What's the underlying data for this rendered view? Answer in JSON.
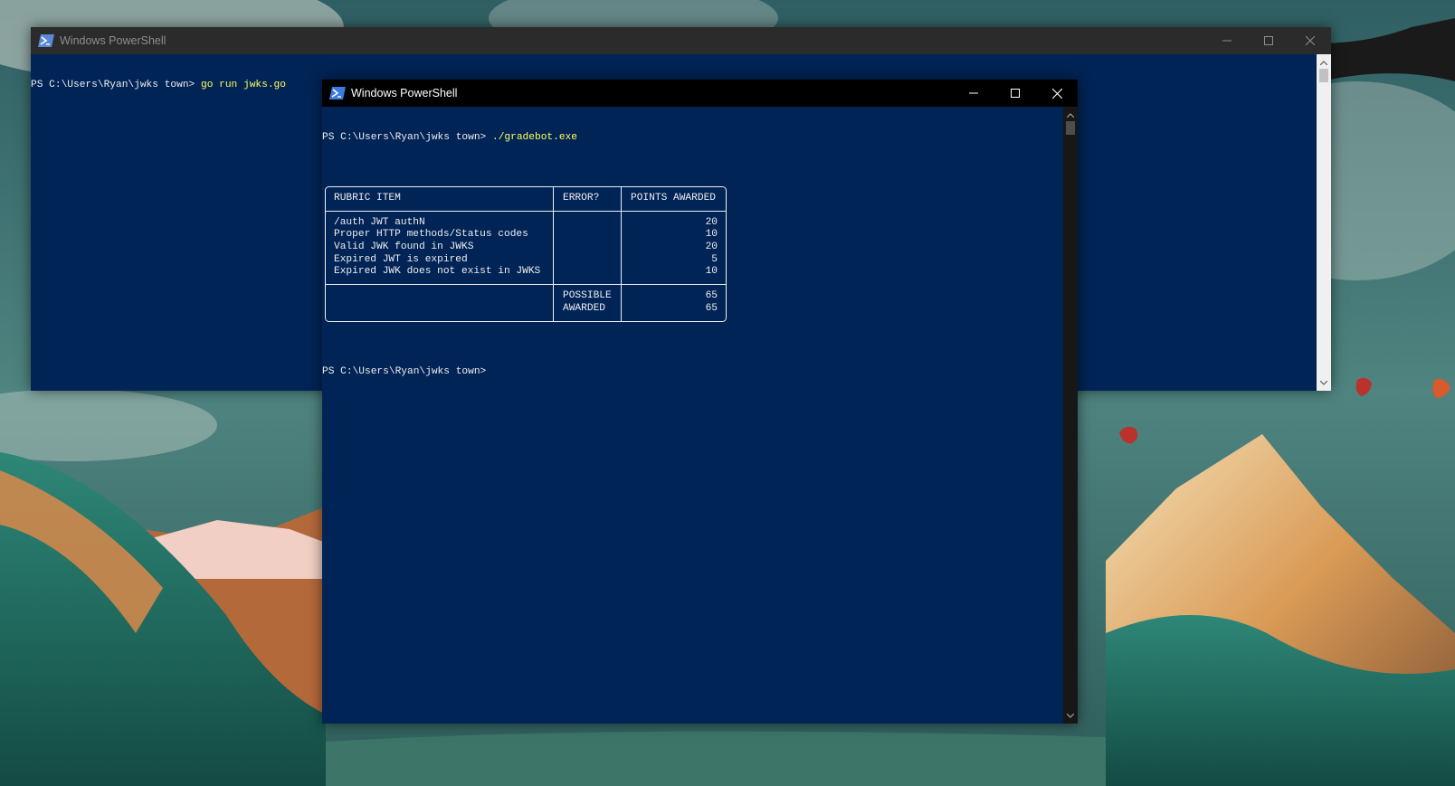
{
  "back_window": {
    "title": "Windows PowerShell",
    "icon": "powershell-icon",
    "prompt": "PS C:\\Users\\Ryan\\jwks town> ",
    "command": "go run jwks.go"
  },
  "front_window": {
    "title": "Windows PowerShell",
    "icon": "powershell-icon",
    "prompt": "PS C:\\Users\\Ryan\\jwks town> ",
    "command": "./gradebot.exe",
    "final_prompt": "PS C:\\Users\\Ryan\\jwks town>"
  },
  "rubric": {
    "headers": {
      "item": "RUBRIC ITEM",
      "error": "ERROR?",
      "points": "POINTS AWARDED"
    },
    "rows": [
      {
        "item": "/auth JWT authN",
        "error": "",
        "points": "20"
      },
      {
        "item": "Proper HTTP methods/Status codes",
        "error": "",
        "points": "10"
      },
      {
        "item": "Valid JWK found in JWKS",
        "error": "",
        "points": "20"
      },
      {
        "item": "Expired JWT is expired",
        "error": "",
        "points": "5"
      },
      {
        "item": "Expired JWK does not exist in JWKS",
        "error": "",
        "points": "10"
      }
    ],
    "footer": [
      {
        "label": "POSSIBLE",
        "value": "65"
      },
      {
        "label": "AWARDED",
        "value": "65"
      }
    ]
  },
  "colors": {
    "console_bg": "#012456",
    "console_text": "#eeedf0",
    "command_text": "#ffff5f"
  }
}
